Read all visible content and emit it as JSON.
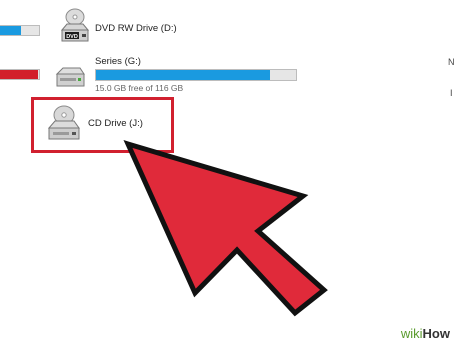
{
  "drives": [
    {
      "label": "DVD RW Drive (D:)",
      "icon": "dvd-drive-icon",
      "icon_text": "DVD"
    },
    {
      "label": "Series (G:)",
      "icon": "usb-drive-icon",
      "free_text": "15.0 GB free of 116 GB",
      "used_fraction": 0.87
    },
    {
      "label": "CD Drive (J:)",
      "icon": "cd-drive-icon"
    }
  ],
  "left_bars": [
    {
      "color": "#1a9ae0",
      "used_fraction": 0.2
    },
    {
      "color": "#d21f2b",
      "used_fraction": 0.95
    }
  ],
  "accent": "#1a9ae0",
  "highlight_color": "#d1202f",
  "arrow_color": "#e02a3a",
  "watermark": {
    "part1": "wiki",
    "part2": "How"
  },
  "right_marks": [
    "N",
    "I"
  ]
}
